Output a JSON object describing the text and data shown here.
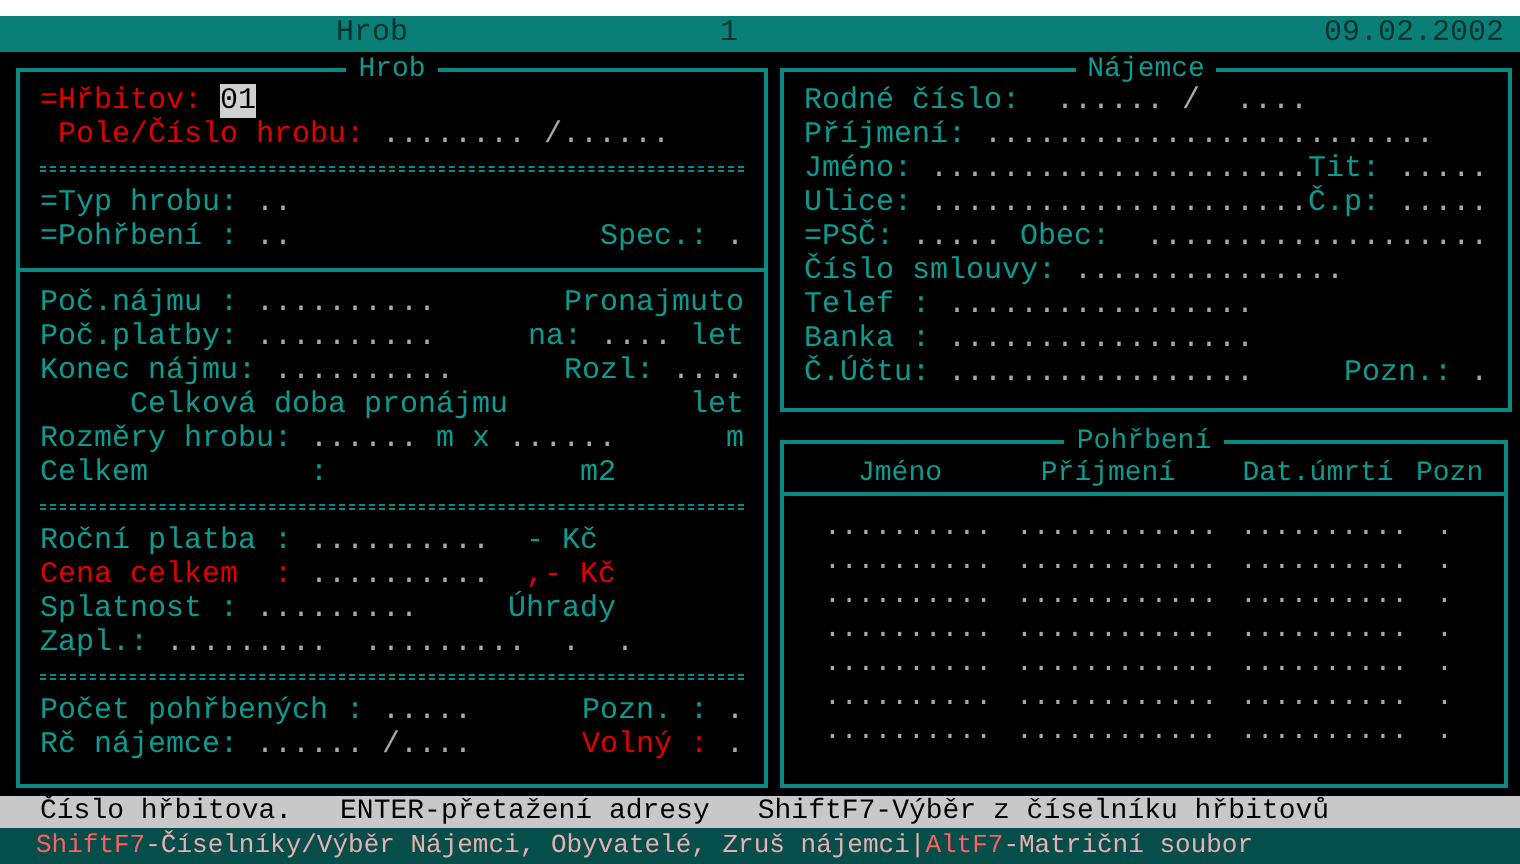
{
  "title_bar": {
    "title": "Hrob",
    "page": "1",
    "date": "09.02.2002"
  },
  "grave_panel": {
    "title": "Hrob",
    "lines": [
      {
        "kind": "fields",
        "left": [
          {
            "kind": "alert",
            "text": "=Hřbitov:"
          },
          {
            "kind": "input",
            "text": "01"
          }
        ]
      },
      {
        "kind": "fields",
        "left": [
          {
            "kind": "alert",
            "text": " Pole/Číslo hrobu:"
          },
          {
            "kind": "value",
            "text": "........ /......"
          }
        ]
      },
      {
        "kind": "rule"
      },
      {
        "kind": "fields",
        "left": [
          {
            "kind": "label",
            "text": "=Typ hrobu:"
          },
          {
            "kind": "value",
            "text": ".."
          }
        ]
      },
      {
        "kind": "fields",
        "left": [
          {
            "kind": "label",
            "text": "=Pohřbení :"
          },
          {
            "kind": "value",
            "text": ".."
          }
        ],
        "right": [
          {
            "kind": "label",
            "text": "Spec.:"
          },
          {
            "kind": "value",
            "text": "."
          }
        ]
      },
      {
        "kind": "divider"
      },
      {
        "kind": "fields",
        "left": [
          {
            "kind": "label",
            "text": "Poč.nájmu :"
          },
          {
            "kind": "value",
            "text": ".........."
          }
        ],
        "right": [
          {
            "kind": "label",
            "text": "Pronajmuto"
          }
        ]
      },
      {
        "kind": "fields",
        "left": [
          {
            "kind": "label",
            "text": "Poč.platby:"
          },
          {
            "kind": "value",
            "text": ".........."
          }
        ],
        "right": [
          {
            "kind": "label",
            "text": "na:"
          },
          {
            "kind": "value",
            "text": "...."
          },
          {
            "kind": "label",
            "text": "let"
          }
        ]
      },
      {
        "kind": "fields",
        "left": [
          {
            "kind": "label",
            "text": "Konec nájmu:"
          },
          {
            "kind": "value",
            "text": ".........."
          }
        ],
        "right": [
          {
            "kind": "label",
            "text": "Rozl:"
          },
          {
            "kind": "value",
            "text": "...."
          }
        ]
      },
      {
        "kind": "fields",
        "left": [
          {
            "kind": "label",
            "text": "     Celková doba pronájmu"
          }
        ],
        "right": [
          {
            "kind": "label",
            "text": "let"
          }
        ]
      },
      {
        "kind": "fields",
        "left": [
          {
            "kind": "label",
            "text": "Rozměry hrobu:"
          },
          {
            "kind": "value",
            "text": "......"
          },
          {
            "kind": "label",
            "text": "m x"
          },
          {
            "kind": "value",
            "text": "......"
          }
        ],
        "right": [
          {
            "kind": "label",
            "text": "m"
          }
        ]
      },
      {
        "kind": "fields",
        "left": [
          {
            "kind": "label",
            "text": "Celkem         :              m2"
          }
        ]
      },
      {
        "kind": "rule"
      },
      {
        "kind": "fields",
        "left": [
          {
            "kind": "label",
            "text": "Roční platba :"
          },
          {
            "kind": "value",
            "text": ".........."
          },
          {
            "kind": "label",
            "text": " - Kč"
          }
        ]
      },
      {
        "kind": "fields",
        "left": [
          {
            "kind": "alert",
            "text": "Cena celkem  :"
          },
          {
            "kind": "value",
            "text": ".........."
          },
          {
            "kind": "alert",
            "text": " ,- Kč"
          }
        ]
      },
      {
        "kind": "fields",
        "left": [
          {
            "kind": "label",
            "text": "Splatnost :"
          },
          {
            "kind": "value",
            "text": "........."
          },
          {
            "kind": "label",
            "text": "    Úhrady"
          }
        ]
      },
      {
        "kind": "fields",
        "left": [
          {
            "kind": "label",
            "text": "Zapl.:"
          },
          {
            "kind": "value",
            "text": ".........  .........  .  ."
          }
        ]
      },
      {
        "kind": "rule"
      },
      {
        "kind": "fields",
        "left": [
          {
            "kind": "label",
            "text": "Počet pohřbených :"
          },
          {
            "kind": "value",
            "text": "....."
          }
        ],
        "right": [
          {
            "kind": "label",
            "text": "Pozn. :"
          },
          {
            "kind": "value",
            "text": "."
          }
        ]
      },
      {
        "kind": "fields",
        "left": [
          {
            "kind": "label",
            "text": "Rč nájemce:"
          },
          {
            "kind": "value",
            "text": "...... /...."
          }
        ],
        "right": [
          {
            "kind": "alert",
            "text": "Volný :"
          },
          {
            "kind": "value",
            "text": "."
          }
        ]
      }
    ]
  },
  "tenant_panel": {
    "title": "Nájemce",
    "lines": [
      {
        "kind": "fields",
        "left": [
          {
            "kind": "label",
            "text": "Rodné číslo:"
          },
          {
            "kind": "value",
            "text": " ...... /  ...."
          }
        ]
      },
      {
        "kind": "fields",
        "left": [
          {
            "kind": "label",
            "text": "Příjmení:"
          },
          {
            "kind": "value",
            "text": "........................."
          }
        ]
      },
      {
        "kind": "fields",
        "left": [
          {
            "kind": "label",
            "text": "Jméno:"
          },
          {
            "kind": "value",
            "text": "....................."
          }
        ],
        "right": [
          {
            "kind": "label",
            "text": "Tit:"
          },
          {
            "kind": "value",
            "text": "....."
          }
        ]
      },
      {
        "kind": "fields",
        "left": [
          {
            "kind": "label",
            "text": "Ulice:"
          },
          {
            "kind": "value",
            "text": "....................."
          }
        ],
        "right": [
          {
            "kind": "label",
            "text": "Č.p:"
          },
          {
            "kind": "value",
            "text": "....."
          }
        ]
      },
      {
        "kind": "fields",
        "left": [
          {
            "kind": "label",
            "text": "=PSČ:"
          },
          {
            "kind": "value",
            "text": "....."
          },
          {
            "kind": "label",
            "text": "Obec:"
          }
        ],
        "right": [
          {
            "kind": "value",
            "text": "..................."
          }
        ]
      },
      {
        "kind": "fields",
        "left": [
          {
            "kind": "label",
            "text": "Číslo smlouvy:"
          },
          {
            "kind": "value",
            "text": "..............."
          }
        ]
      },
      {
        "kind": "fields",
        "left": [
          {
            "kind": "label",
            "text": "Telef :"
          },
          {
            "kind": "value",
            "text": "................."
          }
        ]
      },
      {
        "kind": "fields",
        "left": [
          {
            "kind": "label",
            "text": "Banka :"
          },
          {
            "kind": "value",
            "text": "................."
          }
        ]
      },
      {
        "kind": "fields",
        "left": [
          {
            "kind": "label",
            "text": "Č.Účtu:"
          },
          {
            "kind": "value",
            "text": "................."
          }
        ],
        "right": [
          {
            "kind": "label",
            "text": "Pozn.:"
          },
          {
            "kind": "value",
            "text": "."
          }
        ]
      }
    ]
  },
  "burials_panel": {
    "title": "Pohřbení",
    "columns": [
      "Jméno",
      "Příjmení",
      "Dat.úmrtí",
      "Pozn"
    ],
    "rows": [
      [
        "..........",
        "............",
        "..........",
        "."
      ],
      [
        "..........",
        "............",
        "..........",
        "."
      ],
      [
        "..........",
        "............",
        "..........",
        "."
      ],
      [
        "..........",
        "............",
        "..........",
        "."
      ],
      [
        "..........",
        "............",
        "..........",
        "."
      ],
      [
        "..........",
        "............",
        "..........",
        "."
      ],
      [
        "..........",
        "............",
        "..........",
        "."
      ]
    ]
  },
  "hint_bar": [
    "Číslo hřbitova.",
    "ENTER-přetažení adresy",
    "ShiftF7-Výběr z číselníku hřbitovů"
  ],
  "key_bar": [
    {
      "kind": "key",
      "text": "ShiftF7"
    },
    {
      "kind": "text",
      "text": "-Číselníky/Výběr Nájemci, Obyvatelé, Zruš nájemci|"
    },
    {
      "kind": "key",
      "text": "AltF7"
    },
    {
      "kind": "text",
      "text": "-Matriční soubor"
    }
  ]
}
